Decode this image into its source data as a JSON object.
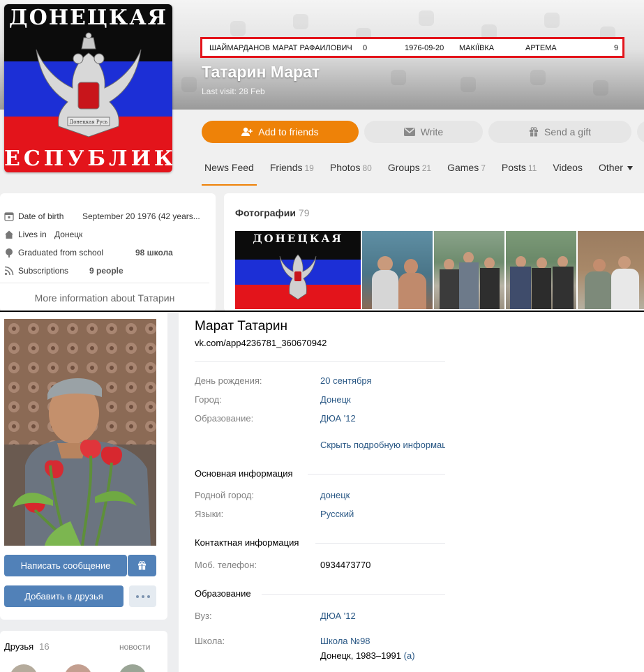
{
  "top": {
    "avatar": {
      "flag_top_text": "ДОНЕЦКАЯ",
      "flag_bottom_text": "ЕСПУБЛИК",
      "emblem_motto": "Донецкая Русь"
    },
    "highlight_row": {
      "name": "ШАЙМАРДАНОВ МАРАТ РАФАИЛОВИЧ",
      "field2": "0",
      "date": "1976-09-20",
      "city": "МАКІЇВКА",
      "street": "АРТЕМА",
      "num": "9"
    },
    "profile_name": "Татарин Марат",
    "last_visit": "Last visit: 28 Feb",
    "actions": {
      "add_friends": "Add to friends",
      "write": "Write",
      "send_gift": "Send a gift"
    },
    "tabs": [
      {
        "label": "News Feed",
        "count": ""
      },
      {
        "label": "Friends",
        "count": "19"
      },
      {
        "label": "Photos",
        "count": "80"
      },
      {
        "label": "Groups",
        "count": "21"
      },
      {
        "label": "Games",
        "count": "7"
      },
      {
        "label": "Posts",
        "count": "11"
      },
      {
        "label": "Videos",
        "count": ""
      },
      {
        "label": "Other",
        "count": ""
      }
    ],
    "info": {
      "dob_label": "Date of birth",
      "dob_value": "September 20 1976 (42 years...",
      "lives_label": "Lives in",
      "lives_value": "Донецк",
      "school_label": "Graduated from school",
      "school_value": "98 школа",
      "subs_label": "Subscriptions",
      "subs_value": "9 people",
      "more": "More information about Татарин"
    },
    "photos": {
      "title": "Фотографии",
      "count": "79"
    }
  },
  "bottom": {
    "name": "Марат Татарин",
    "url": "vk.com/app4236781_360670942",
    "buttons": {
      "message": "Написать сообщение",
      "add_friend": "Добавить в друзья"
    },
    "friends": {
      "title": "Друзья",
      "count": "16",
      "news": "новости"
    },
    "rows": {
      "birthday_label": "День рождения:",
      "birthday_value": "20 сентября",
      "city_label": "Город:",
      "city_value": "Донецк",
      "education_label": "Образование:",
      "education_value": "ДЮА '12",
      "hide_link": "Скрыть подробную информацию"
    },
    "main_info": {
      "title": "Основная информация",
      "hometown_label": "Родной город:",
      "hometown_value": "донецк",
      "languages_label": "Языки:",
      "languages_value": "Русский"
    },
    "contact_info": {
      "title": "Контактная информация",
      "phone_label": "Моб. телефон:",
      "phone_value": "0934473770"
    },
    "education": {
      "title": "Образование",
      "uni_label": "Вуз:",
      "uni_value": "ДЮА '12",
      "school_label": "Школа:",
      "school_value": "Школа №98",
      "school_detail": "Донецк, 1983–1991",
      "school_detail_link": "(а)"
    }
  },
  "colors": {
    "accent_orange": "#ee8208",
    "vk_blue": "#5181b8",
    "vk_link": "#2a5885",
    "highlight_red": "#e3141b"
  }
}
